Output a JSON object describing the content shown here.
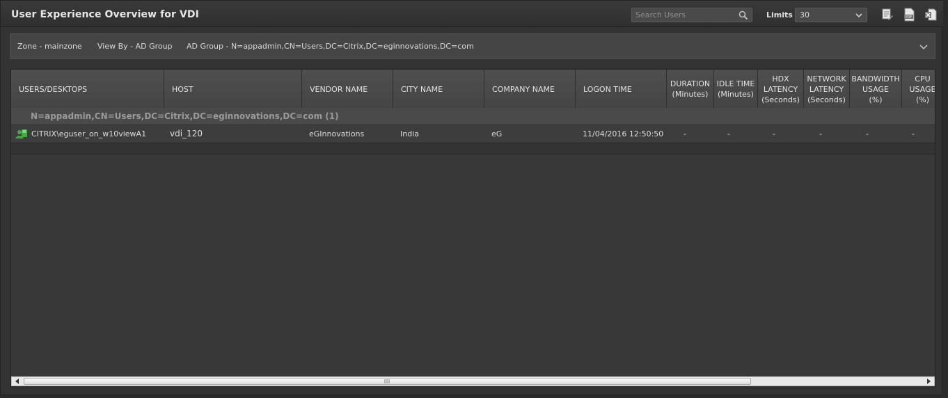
{
  "header": {
    "title": "User Experience Overview for VDI",
    "search_placeholder": "Search Users",
    "limits_label": "Limits",
    "limits_value": "30"
  },
  "filters": {
    "zone": "Zone - mainzone",
    "view_by": "View By - AD Group",
    "ad_group": "AD Group - N=appadmin,CN=Users,DC=Citrix,DC=eginnovations,DC=com"
  },
  "table": {
    "columns": [
      "USERS/DESKTOPS",
      "HOST",
      "VENDOR NAME",
      "CITY NAME",
      "COMPANY NAME",
      "LOGON TIME",
      "DURATION\n(Minutes)",
      "IDLE TIME\n(Minutes)",
      "HDX\nLATENCY\n(Seconds)",
      "NETWORK\nLATENCY\n(Seconds)",
      "BANDWIDTH\nUSAGE\n(%)",
      "CPU\nUSAGE\n(%)"
    ],
    "group_label": "N=appadmin,CN=Users,DC=Citrix,DC=eginnovations,DC=com (1)",
    "rows": [
      {
        "user": "CITRIX\\eguser_on_w10viewA1",
        "host": "vdi_120",
        "vendor": "eGInnovations",
        "city": "India",
        "company": "eG",
        "logon_time": "11/04/2016 12:50:50",
        "duration": "-",
        "idle_time": "-",
        "hdx_latency": "-",
        "network_latency": "-",
        "bandwidth_usage": "-",
        "cpu_usage": "-"
      }
    ]
  },
  "icons": {
    "search": "search-icon",
    "export_doc": "export-document-icon",
    "export_pdf": "export-pdf-icon",
    "export_excel": "export-excel-icon",
    "user": "user-desktop-icon"
  },
  "colors": {
    "background": "#333333",
    "header_bg": "#2f2f2f",
    "accent_user_icon": "#3fae3f"
  }
}
